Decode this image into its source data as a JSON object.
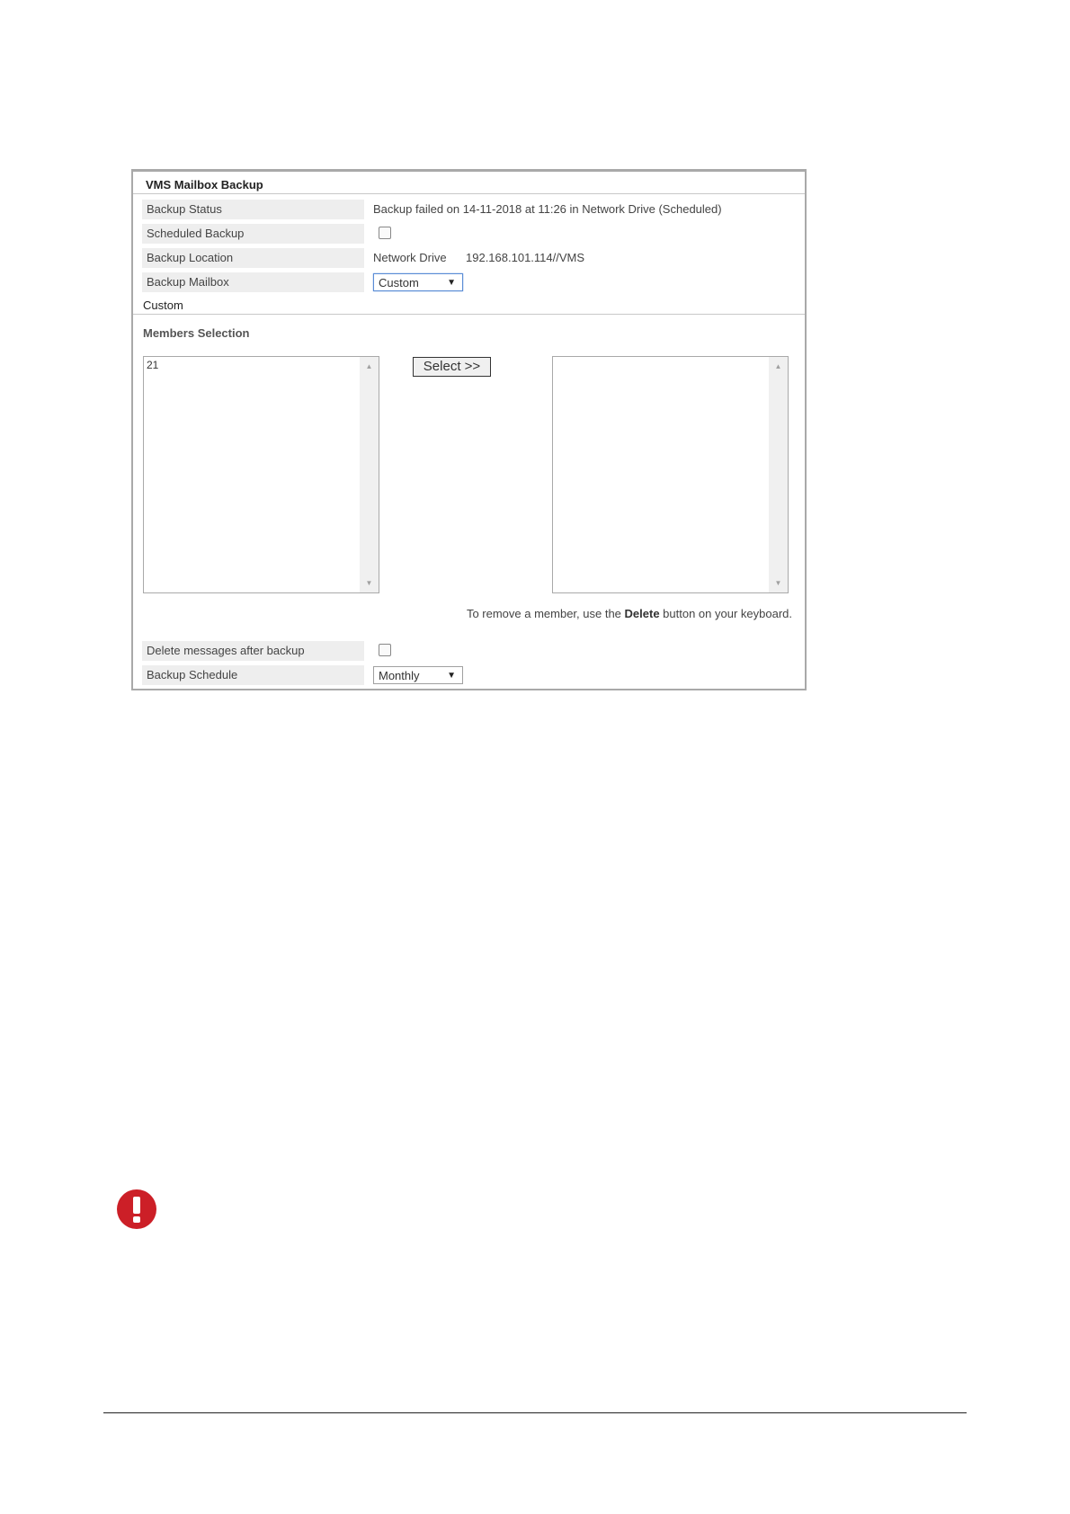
{
  "panel": {
    "title": "VMS Mailbox Backup",
    "backup_status": {
      "label": "Backup Status",
      "value": "Backup failed on 14-11-2018 at 11:26 in Network Drive (Scheduled)"
    },
    "scheduled_backup": {
      "label": "Scheduled Backup",
      "checked": false
    },
    "backup_location": {
      "label": "Backup Location",
      "type": "Network Drive",
      "path": "192.168.101.114//VMS"
    },
    "backup_mailbox": {
      "label": "Backup Mailbox",
      "selected": "Custom"
    },
    "custom_section_label": "Custom",
    "members_selection": {
      "title": "Members Selection",
      "available": [
        "21"
      ],
      "selected": [],
      "select_button": "Select >>",
      "remove_note_before": "To remove a member, use the ",
      "remove_note_key": "Delete",
      "remove_note_after": " button on your keyboard."
    },
    "delete_after_backup": {
      "label": "Delete messages after backup",
      "checked": false
    },
    "backup_schedule": {
      "label": "Backup Schedule",
      "selected": "Monthly"
    }
  },
  "icons": {
    "warning": "exclamation-warning-icon",
    "warning_color": "#cc1f27"
  }
}
